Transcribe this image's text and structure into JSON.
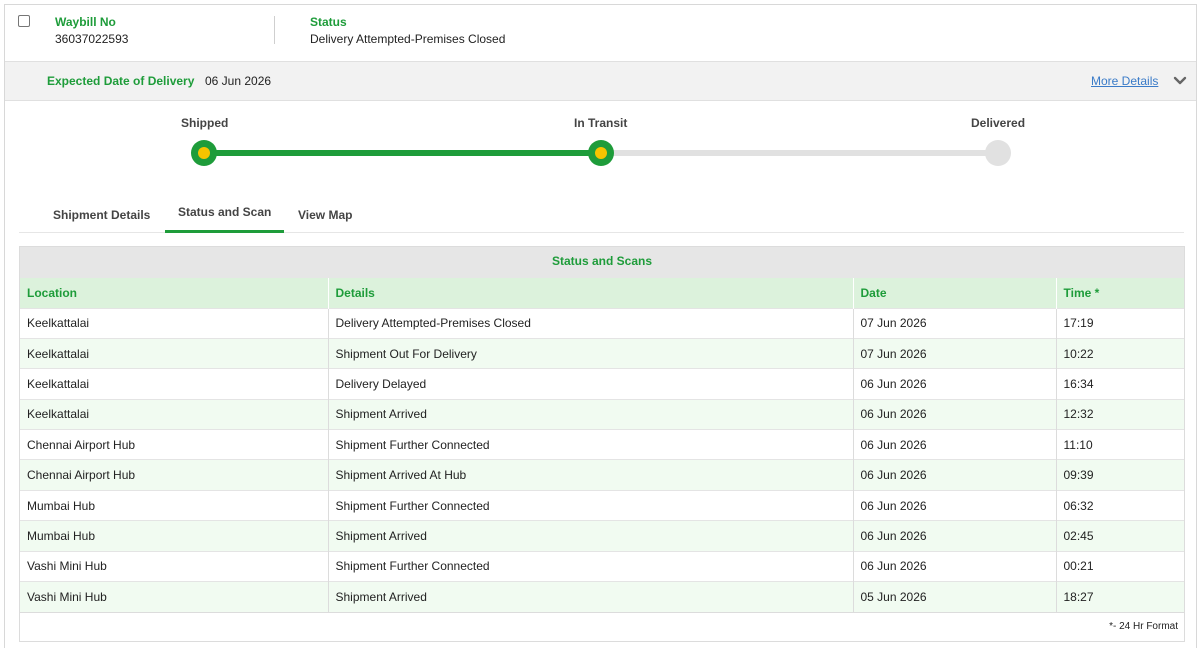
{
  "header": {
    "waybill_label": "Waybill No",
    "waybill_value": "36037022593",
    "status_label": "Status",
    "status_value": "Delivery Attempted-Premises Closed"
  },
  "expected": {
    "label": "Expected Date of Delivery",
    "value": "06 Jun 2026",
    "more_details": "More Details"
  },
  "progress": {
    "steps": [
      {
        "label": "Shipped",
        "state": "done"
      },
      {
        "label": "In Transit",
        "state": "current"
      },
      {
        "label": "Delivered",
        "state": "pending"
      }
    ]
  },
  "tabs": [
    {
      "label": "Shipment Details",
      "active": false
    },
    {
      "label": "Status and Scan",
      "active": true
    },
    {
      "label": "View Map",
      "active": false
    }
  ],
  "scans": {
    "title": "Status and Scans",
    "columns": [
      "Location",
      "Details",
      "Date",
      "Time *"
    ],
    "rows": [
      [
        "Keelkattalai",
        "Delivery Attempted-Premises Closed",
        "07 Jun 2026",
        "17:19"
      ],
      [
        "Keelkattalai",
        "Shipment Out For Delivery",
        "07 Jun 2026",
        "10:22"
      ],
      [
        "Keelkattalai",
        "Delivery Delayed",
        "06 Jun 2026",
        "16:34"
      ],
      [
        "Keelkattalai",
        "Shipment Arrived",
        "06 Jun 2026",
        "12:32"
      ],
      [
        "Chennai Airport Hub",
        "Shipment Further Connected",
        "06 Jun 2026",
        "11:10"
      ],
      [
        "Chennai Airport Hub",
        "Shipment Arrived At Hub",
        "06 Jun 2026",
        "09:39"
      ],
      [
        "Mumbai Hub",
        "Shipment Further Connected",
        "06 Jun 2026",
        "06:32"
      ],
      [
        "Mumbai Hub",
        "Shipment Arrived",
        "06 Jun 2026",
        "02:45"
      ],
      [
        "Vashi Mini Hub",
        "Shipment Further Connected",
        "06 Jun 2026",
        "00:21"
      ],
      [
        "Vashi Mini Hub",
        "Shipment Arrived",
        "05 Jun 2026",
        "18:27"
      ]
    ],
    "footnote": "*- 24 Hr Format"
  },
  "colors": {
    "accent": "#1e9c3a",
    "progress_dot": "#f5c400",
    "link": "#3a7bc8",
    "row_alt": "#f1fbf1"
  },
  "icons": {
    "checkbox": "checkbox-icon",
    "more": "chevron-down-icon"
  }
}
